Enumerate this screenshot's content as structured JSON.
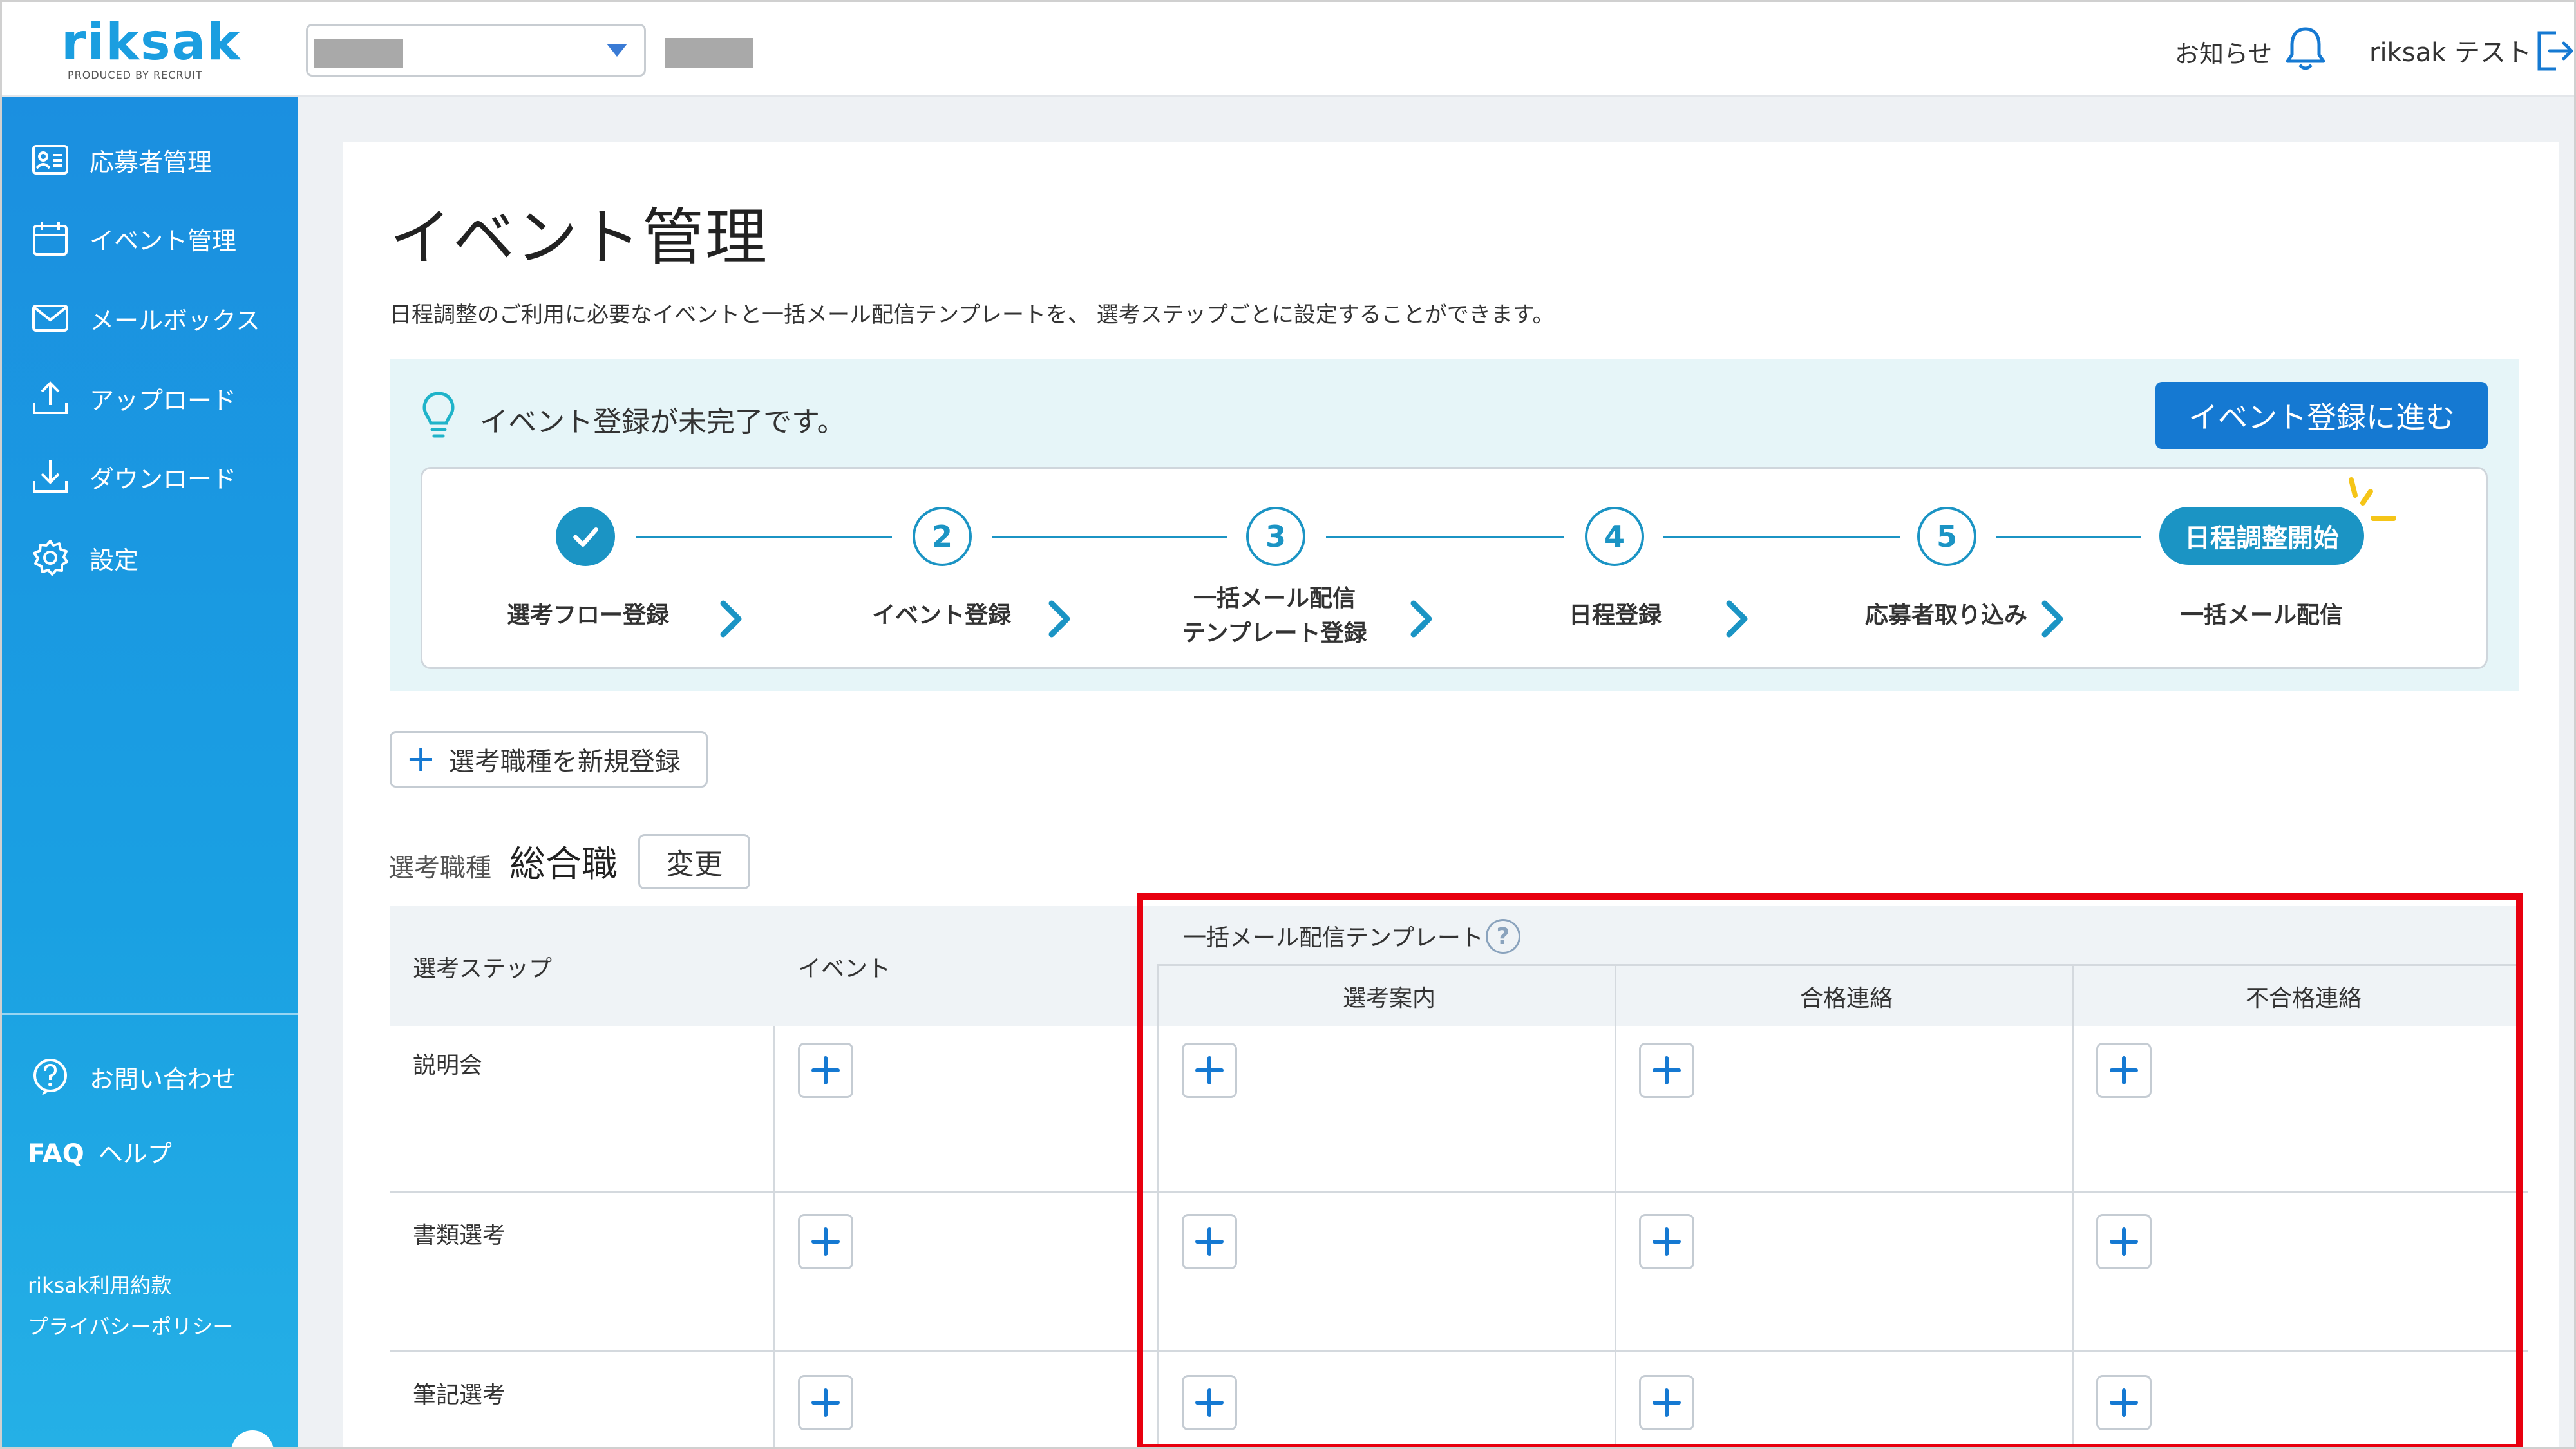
{
  "app": {
    "logo_text": "riksak",
    "logo_sub": "PRODUCED BY RECRUIT"
  },
  "header": {
    "notice_label": "お知らせ",
    "user_name": "riksak テスト"
  },
  "sidebar": {
    "items": [
      {
        "label": "応募者管理",
        "icon": "applicant-card-icon"
      },
      {
        "label": "イベント管理",
        "icon": "calendar-icon"
      },
      {
        "label": "メールボックス",
        "icon": "mail-icon"
      },
      {
        "label": "アップロード",
        "icon": "upload-icon"
      },
      {
        "label": "ダウンロード",
        "icon": "download-icon"
      },
      {
        "label": "設定",
        "icon": "gear-icon"
      }
    ],
    "contact_label": "お問い合わせ",
    "faq_prefix": "FAQ",
    "faq_label": "ヘルプ",
    "terms_label": "riksak利用約款",
    "privacy_label": "プライバシーポリシー"
  },
  "main": {
    "title": "イベント管理",
    "description": "日程調整のご利用に必要なイベントと一括メール配信テンプレートを、 選考ステップごとに設定することができます。",
    "info_message": "イベント登録が未完了です。",
    "go_button": "イベント登録に進む",
    "steps": [
      {
        "number": "",
        "label_line1": "選考フロー登録",
        "label_line2": "",
        "state": "done"
      },
      {
        "number": "2",
        "label_line1": "イベント登録",
        "label_line2": "",
        "state": "todo"
      },
      {
        "number": "3",
        "label_line1": "一括メール配信",
        "label_line2": "テンプレート登録",
        "state": "todo"
      },
      {
        "number": "4",
        "label_line1": "日程登録",
        "label_line2": "",
        "state": "todo"
      },
      {
        "number": "5",
        "label_line1": "応募者取り込み",
        "label_line2": "",
        "state": "todo"
      },
      {
        "number": "",
        "pill": "日程調整開始",
        "label_line1": "一括メール配信",
        "label_line2": "",
        "state": "final"
      }
    ],
    "add_job_button": "選考職種を新規登録",
    "job_type_label": "選考職種",
    "job_type_value": "総合職",
    "change_button": "変更"
  },
  "table": {
    "col_step": "選考ステップ",
    "col_event": "イベント",
    "col_template_group": "一括メール配信テンプレート",
    "sub_cols": [
      "選考案内",
      "合格連絡",
      "不合格連絡"
    ],
    "rows": [
      {
        "step": "説明会"
      },
      {
        "step": "書類選考"
      },
      {
        "step": "筆記選考"
      }
    ]
  },
  "colors": {
    "brand": "#1b9ee0",
    "primary_button": "#1579d2",
    "step_accent": "#1b94c4",
    "highlight_box": "#e8000f"
  }
}
